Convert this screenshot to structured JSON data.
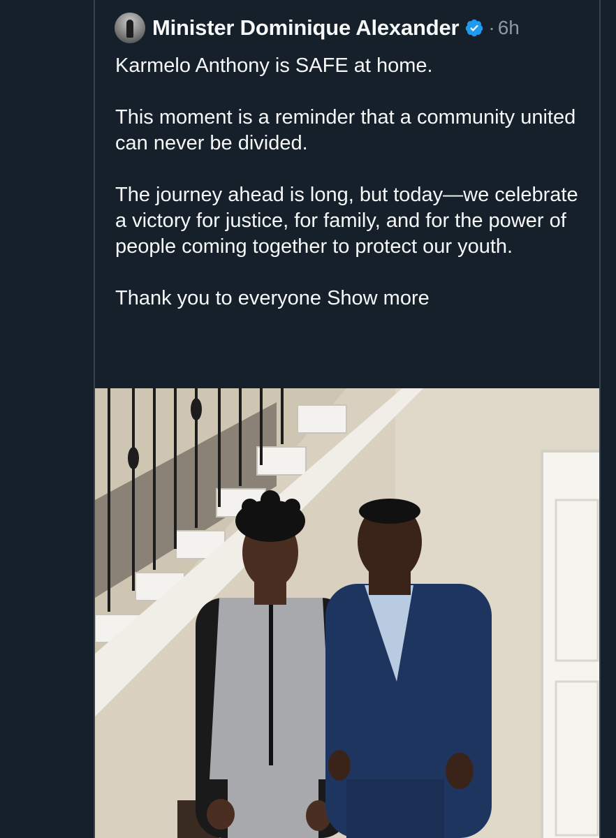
{
  "tweet": {
    "author_name": "Minister Dominique Alexander",
    "separator": "·",
    "time": "6h",
    "paragraphs": [
      "Karmelo Anthony is SAFE at home.",
      "This moment is a reminder that a community united can never be divided.",
      "The journey ahead is long, but today—we celebrate a victory for justice, for family, and for the power of people coming together to protect our youth."
    ],
    "truncated_text": "Thank you to everyone",
    "show_more_label": "Show more",
    "avatar_icon": "profile-avatar",
    "verified_icon": "verified-badge-icon",
    "photo_icon": "tweet-photo"
  },
  "colors": {
    "background": "#15202b",
    "text": "#f7f9f9",
    "muted": "#8b98a5",
    "verified": "#1d9bf0",
    "border": "#38444d"
  }
}
